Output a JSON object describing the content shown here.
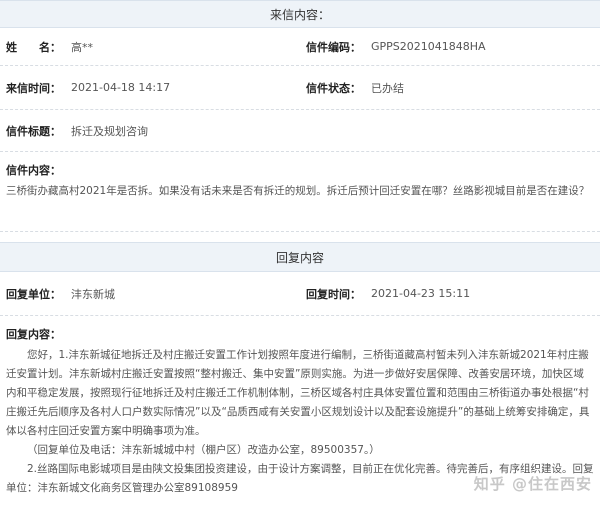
{
  "letter": {
    "header": "来信内容：",
    "name_label": "姓　　名：",
    "name_value": "高**",
    "code_label": "信件编码：",
    "code_value": "GPPS2021041848HA",
    "time_label": "来信时间：",
    "time_value": "2021-04-18 14:17",
    "status_label": "信件状态：",
    "status_value": "已办结",
    "subject_label": "信件标题：",
    "subject_value": "拆迁及规划咨询",
    "content_label": "信件内容：",
    "content_text": "三桥街办藏高村2021年是否拆。如果没有话未来是否有拆迁的规划。拆迁后预计回迁安置在哪？丝路影视城目前是否在建设？"
  },
  "reply": {
    "header": "回复内容",
    "unit_label": "回复单位：",
    "unit_value": "沣东新城",
    "time_label": "回复时间：",
    "time_value": "2021-04-23 15:11",
    "content_label": "回复内容：",
    "paragraphs": [
      "您好，1.沣东新城征地拆迁及村庄搬迁安置工作计划按照年度进行编制，三桥街道藏高村暂未列入沣东新城2021年村庄搬迁安置计划。沣东新城村庄搬迁安置按照“整村搬迁、集中安置”原则实施。为进一步做好安居保障、改善安居环境，加快区域内和平稳定发展，按照现行征地拆迁及村庄搬迁工作机制体制，三桥区域各村庄具体安置位置和范围由三桥街道办事处根据“村庄搬迁先后顺序及各村人口户数实际情况”以及“品质西咸有关安置小区规划设计以及配套设施提升”的基础上统筹安排确定，具体以各村庄回迁安置方案中明确事项为准。",
      "（回复单位及电话：沣东新城城中村（棚户区）改造办公室，89500357。）",
      "2.丝路国际电影城项目是由陕文投集团投资建设，由于设计方案调整，目前正在优化完善。待完善后，有序组织建设。回复单位：沣东新城文化商务区管理办公室89108959"
    ]
  },
  "watermark": "知乎 @住在西安"
}
